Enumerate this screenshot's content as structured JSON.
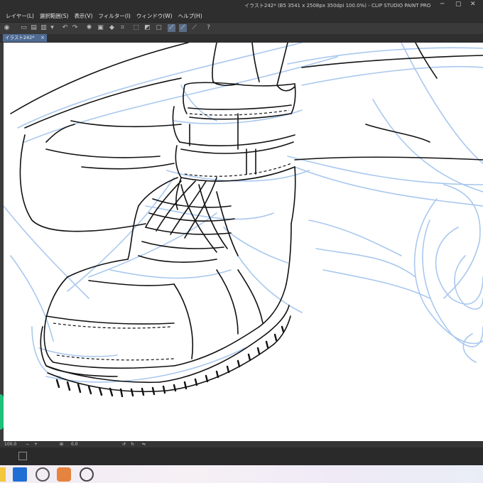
{
  "window": {
    "title": "イラスト242* (B5 3541 x 2508px 350dpi 100.0%) - CLIP STUDIO PAINT PRO"
  },
  "menu": {
    "items": [
      "レイヤー(L)",
      "選択範囲(S)",
      "表示(V)",
      "フィルター(I)",
      "ウィンドウ(W)",
      "ヘルプ(H)"
    ]
  },
  "tab": {
    "label": "イラスト242*",
    "close": "×"
  },
  "status": {
    "zoom": "100.0",
    "angle": "0.0"
  },
  "colors": {
    "sketch_blue": "#a9c8ee",
    "ink": "#111111",
    "accent": "#4f6b93"
  }
}
